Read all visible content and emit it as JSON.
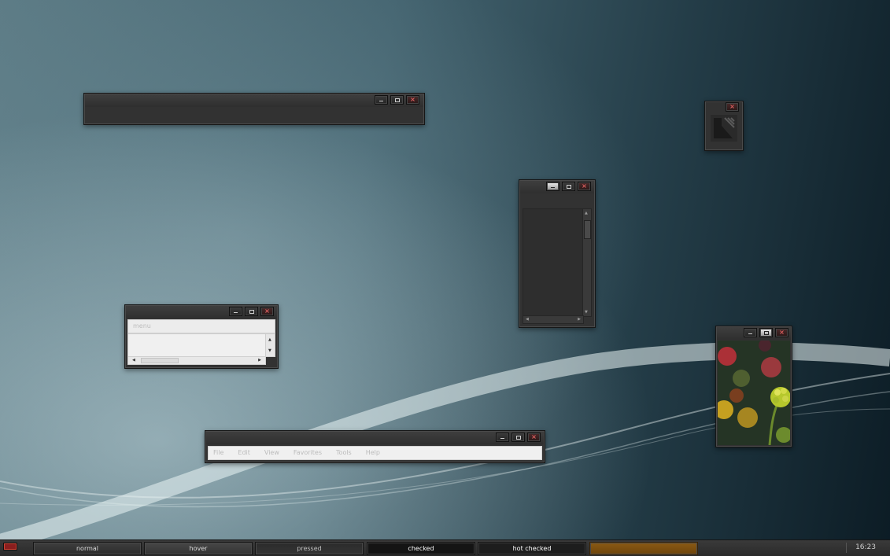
{
  "window_small_menu": {
    "menu_label": "menu"
  },
  "window_menubar": {
    "items": [
      "File",
      "Edit",
      "View",
      "Favorites",
      "Tools",
      "Help"
    ]
  },
  "taskbar": {
    "buttons": [
      {
        "label": "normal",
        "state": "normal"
      },
      {
        "label": "hover",
        "state": "hover"
      },
      {
        "label": "pressed",
        "state": "pressed"
      },
      {
        "label": "checked",
        "state": "checked"
      },
      {
        "label": "hot checked",
        "state": "hot-checked"
      },
      {
        "label": "",
        "state": "progress"
      }
    ],
    "clock": "16:23"
  },
  "colors": {
    "progress": "#8a5a14",
    "close_glyph": "#e06060",
    "start": "#8a1e1e"
  }
}
